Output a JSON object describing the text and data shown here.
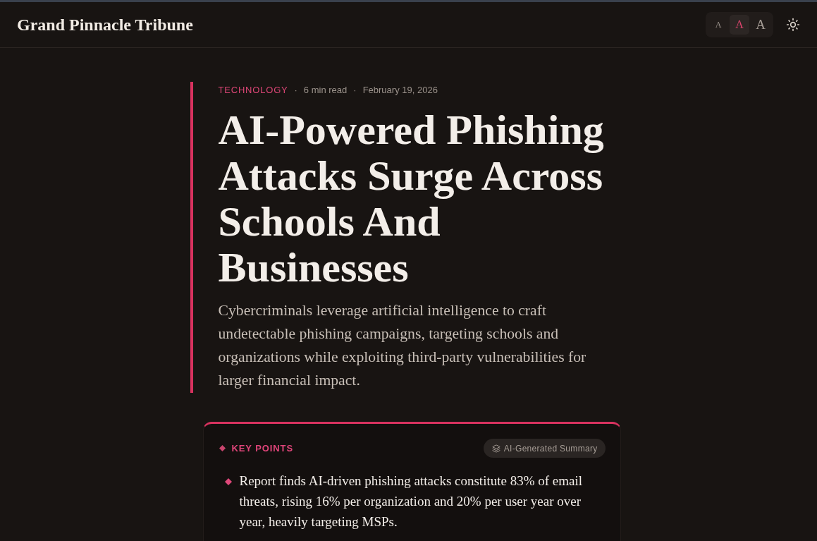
{
  "site": {
    "title": "Grand Pinnacle Tribune"
  },
  "text_size": [
    {
      "label": "A",
      "kind": "small",
      "selected": false
    },
    {
      "label": "A",
      "kind": "medium",
      "selected": true
    },
    {
      "label": "A",
      "kind": "large",
      "selected": false
    }
  ],
  "article": {
    "meta": [
      {
        "kind": "category",
        "text": "TECHNOLOGY"
      },
      {
        "kind": "separator",
        "text": "·"
      },
      {
        "kind": "read_time",
        "text": "6 min read"
      },
      {
        "kind": "separator",
        "text": "·"
      },
      {
        "kind": "date",
        "text": "February 19, 2026"
      }
    ],
    "title": "AI-Powered Phishing Attacks Surge Across Schools And Businesses",
    "summary": "Cybercriminals leverage artificial intelligence to craft undetectable phishing campaigns, targeting schools and organizations while exploiting third-party vulnerabilities for larger financial impact."
  },
  "key_points": {
    "heading": "KEY POINTS",
    "badge": "AI-Generated Summary",
    "items": [
      "Report finds AI-driven phishing attacks constitute 83% of email threats, rising 16% per organization and 20% per user year over year, heavily targeting MSPs."
    ]
  }
}
